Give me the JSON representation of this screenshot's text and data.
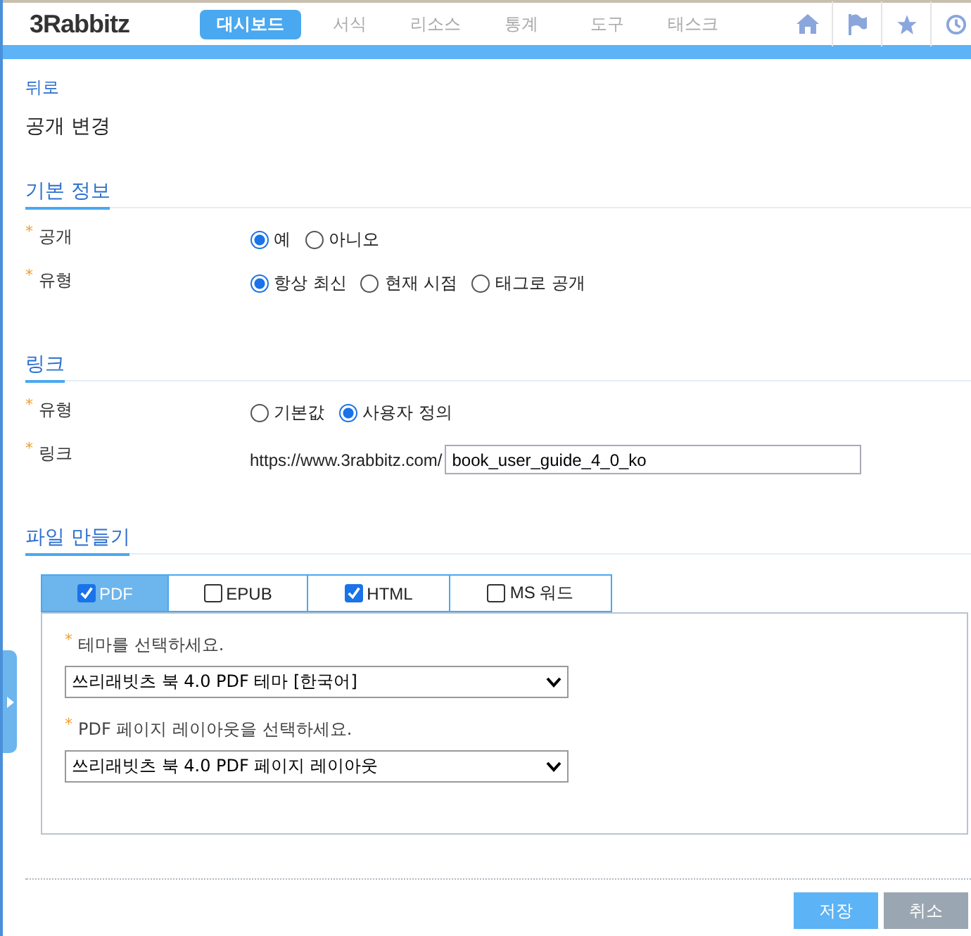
{
  "header": {
    "logo": "3Rabbitz",
    "nav": [
      {
        "label": "대시보드",
        "selected": true
      },
      {
        "label": "서식",
        "selected": false
      },
      {
        "label": "리소스",
        "selected": false
      },
      {
        "label": "통계",
        "selected": false
      },
      {
        "label": "도구",
        "selected": false
      },
      {
        "label": "태스크",
        "selected": false
      }
    ]
  },
  "back_link": "뒤로",
  "page_title": "공개 변경",
  "sections": [
    {
      "title": "기본 정보",
      "rows": [
        {
          "kind": "radio",
          "mark": "*",
          "label": "공개",
          "options": [
            {
              "label": "예",
              "selected": true
            },
            {
              "label": "아니오",
              "selected": false
            }
          ]
        },
        {
          "kind": "radio",
          "mark": "*",
          "label": "유형",
          "options": [
            {
              "label": "항상 최신",
              "selected": true
            },
            {
              "label": "현재 시점",
              "selected": false
            },
            {
              "label": "태그로 공개",
              "selected": false
            }
          ]
        }
      ]
    },
    {
      "title": "링크",
      "rows": [
        {
          "kind": "radio",
          "mark": "*",
          "label": "유형",
          "options": [
            {
              "label": "기본값",
              "selected": false
            },
            {
              "label": "사용자 정의",
              "selected": true
            }
          ]
        },
        {
          "kind": "link",
          "mark": "*",
          "label": "링크",
          "prefix": "https://www.3rabbitz.com/",
          "value": "book_user_guide_4_0_ko"
        }
      ]
    }
  ],
  "file_section": {
    "title": "파일 만들기",
    "tabs": [
      {
        "label": "PDF",
        "checked": true,
        "selected": true
      },
      {
        "label": "EPUB",
        "checked": false,
        "selected": false
      },
      {
        "label": "HTML",
        "checked": true,
        "selected": false
      },
      {
        "label": "MS 워드",
        "checked": false,
        "selected": false
      }
    ],
    "fields": [
      {
        "mark": "*",
        "label": "테마를 선택하세요.",
        "value": "쓰리래빗츠 북 4.0 PDF 테마 [한국어]"
      },
      {
        "mark": "*",
        "label": "PDF 페이지 레이아웃을 선택하세요.",
        "value": "쓰리래빗츠 북 4.0 PDF 페이지 레이아웃"
      }
    ]
  },
  "buttons": [
    {
      "label": "저장",
      "disabled": false
    },
    {
      "label": "취소",
      "disabled": true
    }
  ]
}
